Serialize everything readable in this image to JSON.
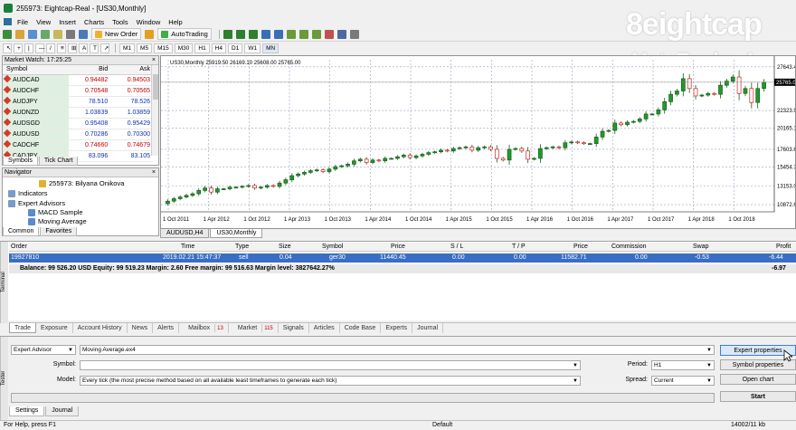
{
  "window": {
    "title": "255973: Eightcap-Real - [US30,Monthly]"
  },
  "brand": {
    "name": "eightcap",
    "sub": "MetaTrader 4",
    "mark": "8"
  },
  "menu": [
    "File",
    "View",
    "Insert",
    "Charts",
    "Tools",
    "Window",
    "Help"
  ],
  "toolbar": {
    "new_order": "New Order",
    "autotrading": "AutoTrading"
  },
  "timeframes": [
    "M1",
    "M5",
    "M15",
    "M30",
    "H1",
    "H4",
    "D1",
    "W1",
    "MN"
  ],
  "market_watch": {
    "title": "Market Watch: 17:25:25",
    "columns": [
      "Symbol",
      "Bid",
      "Ask"
    ],
    "rows": [
      {
        "symbol": "AUDCAD",
        "bid": "0.94482",
        "ask": "0.94503",
        "dir": "down"
      },
      {
        "symbol": "AUDCHF",
        "bid": "0.70548",
        "ask": "0.70565",
        "dir": "down"
      },
      {
        "symbol": "AUDJPY",
        "bid": "78.510",
        "ask": "78.526",
        "dir": "up"
      },
      {
        "symbol": "AUDNZD",
        "bid": "1.03839",
        "ask": "1.03859",
        "dir": "up"
      },
      {
        "symbol": "AUDSGD",
        "bid": "0.95408",
        "ask": "0.95429",
        "dir": "up"
      },
      {
        "symbol": "AUDUSD",
        "bid": "0.70286",
        "ask": "0.70300",
        "dir": "up"
      },
      {
        "symbol": "CADCHF",
        "bid": "0.74660",
        "ask": "0.74679",
        "dir": "down"
      },
      {
        "symbol": "CADJPY",
        "bid": "83.096",
        "ask": "83.105",
        "dir": "up"
      }
    ],
    "tabs": [
      "Symbols",
      "Tick Chart"
    ]
  },
  "navigator": {
    "title": "Navigator",
    "items": [
      "255973: Bilyana Onikova",
      "Indicators",
      "Expert Advisors",
      "MACD Sample",
      "Moving Average"
    ],
    "tabs": [
      "Common",
      "Favorites"
    ]
  },
  "chart": {
    "header": "US30,Monthly  25919.50 26169.10 25608.00 25765.00",
    "price_labels": [
      "27643.45",
      "25765.0",
      "22323.90",
      "20165.15",
      "17603.60",
      "15454.75",
      "13153.00",
      "10872.65"
    ],
    "date_labels": [
      "1 Oct 2011",
      "1 Apr 2012",
      "1 Oct 2012",
      "1 Apr 2013",
      "1 Oct 2013",
      "1 Apr 2014",
      "1 Oct 2014",
      "1 Apr 2015",
      "1 Oct 2015",
      "1 Apr 2016",
      "1 Oct 2016",
      "1 Apr 2017",
      "1 Oct 2017",
      "1 Apr 2018",
      "1 Oct 2018"
    ],
    "tabs": [
      "AUDUSD,H4",
      "US30,Monthly"
    ]
  },
  "chart_data": {
    "type": "candlestick",
    "symbol": "US30",
    "timeframe": "Monthly",
    "ohlc_last": {
      "open": 25919.5,
      "high": 26169.1,
      "low": 25608.0,
      "close": 25765.0
    },
    "y_ticks": [
      10872.65,
      13153.0,
      15454.75,
      17603.6,
      20165.15,
      22323.9,
      25765.0,
      27643.45
    ],
    "ylim": [
      10000,
      28500
    ],
    "x_ticks": [
      "1 Oct 2011",
      "1 Apr 2012",
      "1 Oct 2012",
      "1 Apr 2013",
      "1 Oct 2013",
      "1 Apr 2014",
      "1 Oct 2014",
      "1 Apr 2015",
      "1 Oct 2015",
      "1 Apr 2016",
      "1 Oct 2016",
      "1 Apr 2017",
      "1 Oct 2017",
      "1 Apr 2018",
      "1 Oct 2018"
    ],
    "closes": [
      11300,
      11600,
      11800,
      12000,
      12200,
      12600,
      12900,
      12400,
      12800,
      12800,
      13000,
      13000,
      13100,
      13200,
      12900,
      13000,
      13200,
      13100,
      13500,
      13900,
      14400,
      14600,
      14800,
      15000,
      15100,
      14900,
      15200,
      15500,
      15600,
      15800,
      16200,
      16400,
      16000,
      16300,
      16200,
      16500,
      16500,
      16700,
      16900,
      16600,
      16800,
      17000,
      17200,
      17300,
      17500,
      17400,
      17700,
      17800,
      17900,
      17500,
      17800,
      17900,
      17600,
      16500,
      16300,
      17600,
      17700,
      17400,
      16400,
      16500,
      17700,
      17800,
      17900,
      17800,
      18400,
      18500,
      18400,
      18300,
      18300,
      19100,
      19800,
      19900,
      20800,
      20600,
      20900,
      21000,
      21300,
      21900,
      21900,
      22400,
      23400,
      24300,
      24700,
      26200,
      25000,
      24100,
      24200,
      24400,
      24300,
      25400,
      25900,
      26400,
      24400,
      25000,
      23300,
      25000,
      25765
    ]
  },
  "terminal": {
    "columns": [
      "Order",
      "Time",
      "Type",
      "Size",
      "Symbol",
      "Price",
      "S / L",
      "T / P",
      "Price",
      "Commission",
      "Swap",
      "Profit"
    ],
    "order": {
      "id": "19927810",
      "time": "2019.02.21 15:47:37",
      "type": "sell",
      "size": "0.04",
      "symbol": "ger30",
      "price": "11440.45",
      "sl": "0.00",
      "tp": "0.00",
      "cur_price": "11582.71",
      "commission": "0.00",
      "swap": "-0.53",
      "profit": "-6.44"
    },
    "balance_line": "Balance: 99 526.20 USD  Equity: 99 519.23  Margin: 2.60  Free margin: 99 516.63  Margin level: 3827642.27%",
    "total": "-6.97",
    "side_label": "Terminal",
    "tabs": [
      "Trade",
      "Exposure",
      "Account History",
      "News",
      "Alerts",
      "Mailbox",
      "Market",
      "Signals",
      "Articles",
      "Code Base",
      "Experts",
      "Journal"
    ],
    "mailbox_badge": "13",
    "market_badge": "115"
  },
  "tester": {
    "side_label": "Tester",
    "mode": "Expert Advisor",
    "expert": "Moving Average.ex4",
    "symbol_label": "Symbol:",
    "model_label": "Model:",
    "model": "Every tick (the most precise method based on all available least timeframes to generate each tick)",
    "period_label": "Period:",
    "period": "H1",
    "spread_label": "Spread:",
    "spread": "Current",
    "buttons": [
      "Expert properties",
      "Symbol properties",
      "Open chart",
      "Start"
    ],
    "tabs": [
      "Settings",
      "Journal"
    ]
  },
  "status": {
    "help": "For Help, press F1",
    "profile": "Default",
    "traffic": "14002/11 kb"
  }
}
